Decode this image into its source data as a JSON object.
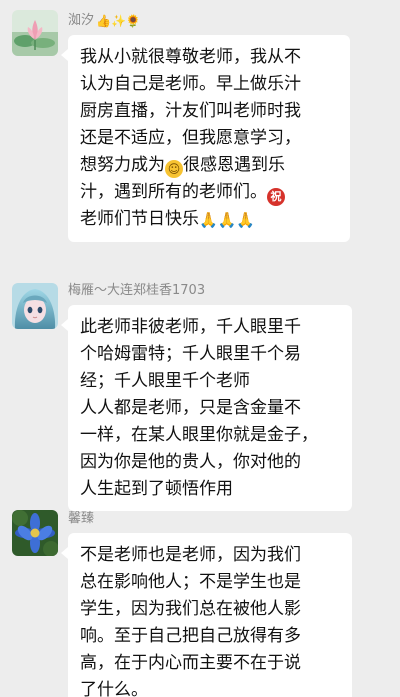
{
  "messages": [
    {
      "sender": "洳汐",
      "sender_emojis": "👍✨🌻",
      "lines": [
        "我从小就很尊敬老师，我从不",
        "认为自己是老师。早上做乐汁",
        "厨房直播，汁友们叫老师时我",
        "还是不适应，但我愿意学习，",
        "想努力成为",
        "很感恩遇到乐",
        "汁，遇到所有的老师们。",
        "老师们节日快乐"
      ],
      "inline_emojis": {
        "smile": "☺",
        "zhu": "祝",
        "pray": "🙏🙏🙏"
      }
    },
    {
      "sender": "梅雁～大连郑桂香1703",
      "lines": [
        "此老师非彼老师，千人眼里千",
        "个哈姆雷特；千人眼里千个易",
        "经；千人眼里千个老师",
        "人人都是老师，只是含金量不",
        "一样，在某人眼里你就是金子，",
        "因为你是他的贵人，你对他的",
        "人生起到了顿悟作用"
      ]
    },
    {
      "sender": "馨臻",
      "lines": [
        "不是老师也是老师，因为我们",
        "总在影响他人；不是学生也是",
        "学生，因为我们总在被他人影",
        "响。至于自己把自己放得有多",
        "高，在于内心而主要不在于说",
        "了什么。"
      ]
    }
  ],
  "colors": {
    "background": "#ededed",
    "bubble": "#ffffff",
    "name": "#8a8a8a",
    "text": "#111111"
  },
  "icons": {
    "avatar1": "lotus-painting-avatar-icon",
    "avatar2": "anime-girl-avatar-icon",
    "avatar3": "blue-flower-avatar-icon"
  }
}
